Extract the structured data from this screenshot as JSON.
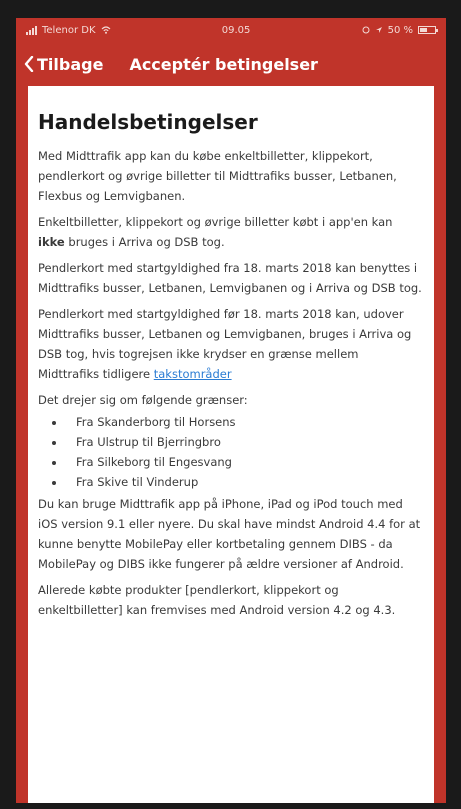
{
  "status_bar": {
    "carrier": "Telenor DK",
    "time": "09.05",
    "battery": "50 %"
  },
  "nav": {
    "back_label": "Tilbage",
    "title": "Acceptér betingelser"
  },
  "content": {
    "heading": "Handelsbetingelser",
    "p1": "Med Midttrafik app kan du købe enkeltbilletter, klippekort, pendlerkort og øvrige billetter til Midttrafiks busser, Letbanen, Flexbus og Lemvigbanen.",
    "p2_before": "Enkeltbilletter, klippekort og øvrige billetter købt i app'en kan ",
    "p2_bold": "ikke",
    "p2_after": " bruges i Arriva og DSB tog.",
    "p3": "Pendlerkort med startgyldighed fra 18. marts 2018 kan benyttes i Midttrafiks busser, Letbanen, Lemvigbanen og i Arriva og DSB tog.",
    "p4_before": "Pendlerkort med startgyldighed før 18. marts 2018 kan, udover Midttrafiks busser, Letbanen og Lemvigbanen, bruges i Arriva og DSB tog, hvis togrejsen ikke krydser en grænse mellem Midttrafiks tidligere ",
    "p4_link": "takstområder",
    "p5": "Det drejer sig om følgende grænser:",
    "borders": [
      "Fra Skanderborg til Horsens",
      "Fra Ulstrup til Bjerringbro",
      "Fra Silkeborg til Engesvang",
      "Fra Skive til Vinderup"
    ],
    "p6": "Du kan bruge Midttrafik app på iPhone, iPad og iPod touch med iOS version 9.1 eller nyere. Du skal have mindst Android 4.4 for at kunne benytte MobilePay eller kortbetaling gennem DIBS - da MobilePay og DIBS ikke fungerer på ældre versioner af Android.",
    "p7": "Allerede købte produkter [pendlerkort, klippekort og enkeltbilletter] kan fremvises med Android version 4.2 og 4.3."
  },
  "colors": {
    "brand_red": "#c0342a",
    "link_blue": "#2b7cd3"
  },
  "battery_level": 0.5
}
